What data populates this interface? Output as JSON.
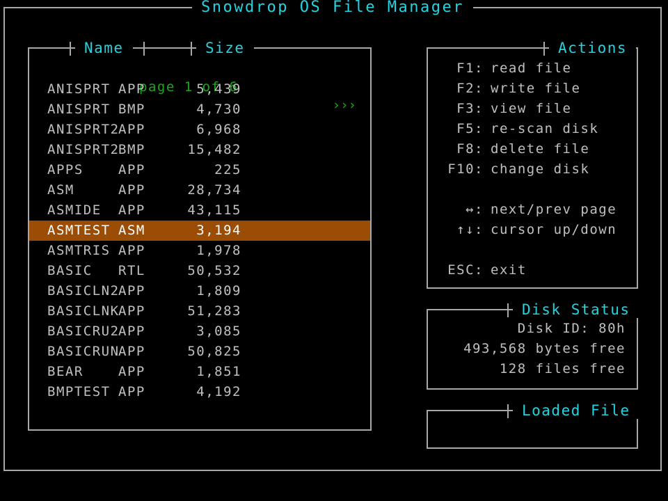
{
  "window": {
    "title": "Snowdrop OS File Manager"
  },
  "file_panel": {
    "header_name": "Name",
    "header_size": "Size",
    "page_label": "page 1 of 6",
    "next_page_indicator": "›››",
    "page_current": 1,
    "page_total": 6,
    "selected_index": 7,
    "rows": [
      {
        "name": "ANISPRT",
        "ext": "APP",
        "size": "5,439"
      },
      {
        "name": "ANISPRT",
        "ext": "BMP",
        "size": "4,730"
      },
      {
        "name": "ANISPRT2",
        "ext": "APP",
        "size": "6,968"
      },
      {
        "name": "ANISPRT2",
        "ext": "BMP",
        "size": "15,482"
      },
      {
        "name": "APPS",
        "ext": "APP",
        "size": "225"
      },
      {
        "name": "ASM",
        "ext": "APP",
        "size": "28,734"
      },
      {
        "name": "ASMIDE",
        "ext": "APP",
        "size": "43,115"
      },
      {
        "name": "ASMTEST",
        "ext": "ASM",
        "size": "3,194"
      },
      {
        "name": "ASMTRIS",
        "ext": "APP",
        "size": "1,978"
      },
      {
        "name": "BASIC",
        "ext": "RTL",
        "size": "50,532"
      },
      {
        "name": "BASICLN2",
        "ext": "APP",
        "size": "1,809"
      },
      {
        "name": "BASICLNK",
        "ext": "APP",
        "size": "51,283"
      },
      {
        "name": "BASICRU2",
        "ext": "APP",
        "size": "3,085"
      },
      {
        "name": "BASICRUN",
        "ext": "APP",
        "size": "50,825"
      },
      {
        "name": "BEAR",
        "ext": "APP",
        "size": "1,851"
      },
      {
        "name": "BMPTEST",
        "ext": "APP",
        "size": "4,192"
      }
    ]
  },
  "actions_panel": {
    "title": "Actions",
    "items": [
      {
        "key": "F1:",
        "desc": "read file"
      },
      {
        "key": "F2:",
        "desc": "write file"
      },
      {
        "key": "F3:",
        "desc": "view file"
      },
      {
        "key": "F5:",
        "desc": "re-scan disk"
      },
      {
        "key": "F8:",
        "desc": "delete file"
      },
      {
        "key": "F10:",
        "desc": "change disk"
      },
      {
        "key": "",
        "desc": ""
      },
      {
        "key": "↔:",
        "desc": "next/prev page"
      },
      {
        "key": "↑↓:",
        "desc": "cursor up/down"
      },
      {
        "key": "",
        "desc": ""
      },
      {
        "key": "ESC:",
        "desc": "exit"
      }
    ]
  },
  "disk_panel": {
    "title": "Disk Status",
    "lines": [
      "Disk ID: 80h",
      "493,568 bytes free",
      "128 files free"
    ]
  },
  "loaded_panel": {
    "title": "Loaded File",
    "content": ""
  },
  "colors": {
    "background": "#000000",
    "border": "#a8a8a8",
    "text": "#c0c0c0",
    "legend": "#22d3e0",
    "page_info": "#17aa17",
    "highlight_bg": "#9c4d05",
    "highlight_text": "#ffffff"
  }
}
